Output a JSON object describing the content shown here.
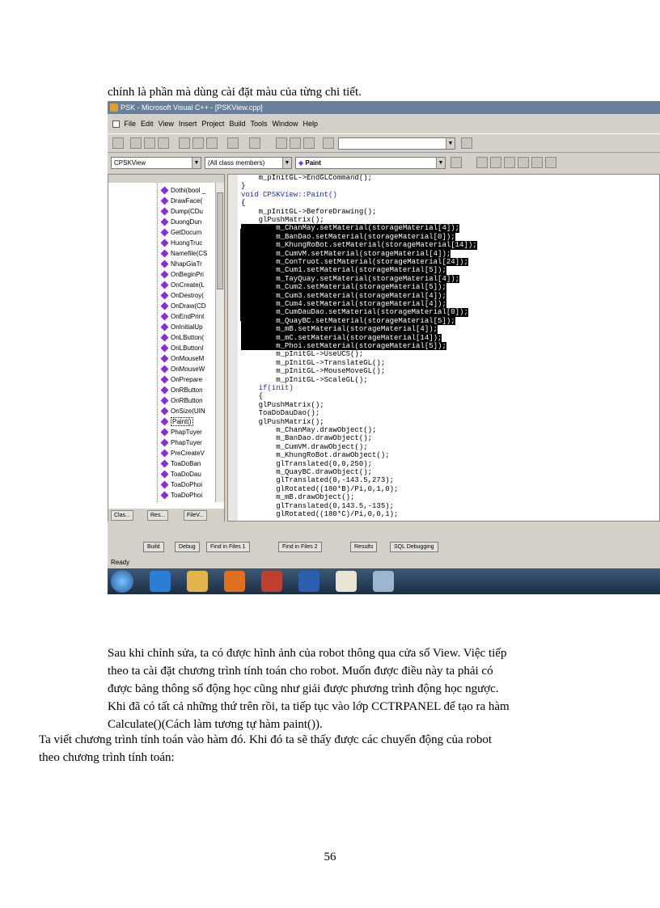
{
  "top_caption": "chính là phần mà dùng cài đặt màu của từng chi tiết.",
  "screenshot": {
    "title": "PSK - Microsoft Visual C++ - [PSKView.cpp]",
    "menu": [
      "File",
      "Edit",
      "View",
      "Insert",
      "Project",
      "Build",
      "Tools",
      "Window",
      "Help"
    ],
    "class_combo": "CPSKView",
    "members_combo": "(All class members)",
    "method_combo": "Paint",
    "class_tree": [
      "Dothi(bool _",
      "DrawFace(",
      "Dump(CDu",
      "DuongDun",
      "GetDocum",
      "HuongTruc",
      "Namefile(CS",
      "NhapGiaTr",
      "OnBeginPri",
      "OnCreate(L",
      "OnDestroy(",
      "OnDraw(CD",
      "OnEndPrint",
      "OnInitialUp",
      "OnLButton(",
      "OnLButtonI",
      "OnMouseM",
      "OnMouseW",
      "OnPrepare",
      "OnRButton",
      "OnRButton",
      "OnSize(UIN",
      "Paint()",
      "PhapTuyer",
      "PhapTuyer",
      "PreCreateV",
      "ToaDoBan",
      "ToaDoDau",
      "ToaDoPhoi",
      "ToaDoPhoi"
    ],
    "selected_item": "Paint()",
    "cv_tabs": [
      "Clas...",
      "Res...",
      "FileV..."
    ],
    "code_lines": [
      {
        "text": "    m_pInitGL->EndGLCommand();",
        "kind": "normal"
      },
      {
        "text": "}",
        "kind": "normal"
      },
      {
        "text": "void CPSKView::Paint()",
        "kind": "keyword"
      },
      {
        "text": "{",
        "kind": "normal"
      },
      {
        "text": "    m_pInitGL->BeforeDrawing();",
        "kind": "normal"
      },
      {
        "text": "    glPushMatrix();",
        "kind": "normal"
      },
      {
        "text": "        m_ChanMay.setMaterial(storageMaterial[4]);",
        "kind": "highlight"
      },
      {
        "text": "        m_BanDao.setMaterial(storageMaterial[0]);",
        "kind": "highlight"
      },
      {
        "text": "        m_KhungRoBot.setMaterial(storageMaterial[14]);",
        "kind": "highlight"
      },
      {
        "text": "        m_CumVM.setMaterial(storageMaterial[4]);",
        "kind": "highlight"
      },
      {
        "text": "        m_ConTruot.setMaterial(storageMaterial[24]);",
        "kind": "highlight"
      },
      {
        "text": "        m_Cum1.setMaterial(storageMaterial[5]);",
        "kind": "highlight"
      },
      {
        "text": "        m_TayQuay.setMaterial(storageMaterial[4]);",
        "kind": "highlight"
      },
      {
        "text": "        m_Cum2.setMaterial(storageMaterial[5]);",
        "kind": "highlight"
      },
      {
        "text": "        m_Cum3.setMaterial(storageMaterial[4]);",
        "kind": "highlight"
      },
      {
        "text": "        m_Cum4.setMaterial(storageMaterial[4]);",
        "kind": "highlight"
      },
      {
        "text": "        m_CumDauDao.setMaterial(storageMaterial[0]);",
        "kind": "highlight"
      },
      {
        "text": "        m_QuayBC.setMaterial(storageMaterial[5]);",
        "kind": "highlight"
      },
      {
        "text": "        m_mB.setMaterial(storageMaterial[4]);",
        "kind": "highlight"
      },
      {
        "text": "        m_mC.setMaterial(storageMaterial[14]);",
        "kind": "highlight"
      },
      {
        "text": "        m_Phoi.setMaterial(storageMaterial[5]);",
        "kind": "highlight"
      },
      {
        "text": "        m_pInitGL->UseUCS();",
        "kind": "normal"
      },
      {
        "text": "        m_pInitGL->TranslateGL();",
        "kind": "normal"
      },
      {
        "text": "        m_pInitGL->MouseMoveGL();",
        "kind": "normal"
      },
      {
        "text": "        m_pInitGL->ScaleGL();",
        "kind": "normal"
      },
      {
        "text": "    if(init)",
        "kind": "keyword"
      },
      {
        "text": "    {",
        "kind": "normal"
      },
      {
        "text": "    glPushMatrix();",
        "kind": "normal"
      },
      {
        "text": "    ToaDoDauDao();",
        "kind": "normal"
      },
      {
        "text": "    glPushMatrix();",
        "kind": "normal"
      },
      {
        "text": "        m_ChanMay.drawObject();",
        "kind": "normal"
      },
      {
        "text": "        m_BanDao.drawObject();",
        "kind": "normal"
      },
      {
        "text": "        m_CumVM.drawObject();",
        "kind": "normal"
      },
      {
        "text": "        m_KhungRoBot.drawObject();",
        "kind": "normal"
      },
      {
        "text": "        glTranslated(0,0,250);",
        "kind": "normal"
      },
      {
        "text": "        m_QuayBC.drawObject();",
        "kind": "normal"
      },
      {
        "text": "        glTranslated(0,-143.5,273);",
        "kind": "normal"
      },
      {
        "text": "        glRotated((180*B)/Pi,0,1,0);",
        "kind": "normal"
      },
      {
        "text": "        m_mB.drawObject();",
        "kind": "normal"
      },
      {
        "text": "        glTranslated(0,143.5,-135);",
        "kind": "normal"
      },
      {
        "text": "        glRotated((180*C)/Pi,0,0,1);",
        "kind": "normal"
      }
    ],
    "output_tabs": [
      "Build",
      "Debug",
      "Find in Files 1",
      "Find in Files 2",
      "Results",
      "SQL Debugging"
    ],
    "status": "Ready"
  },
  "paragraph_lines": [
    "Sau khi chỉnh sửa, ta có được hình ảnh của robot thông qua cửa sổ View. Việc tiếp",
    "theo ta cài đặt chương trình tính toán cho robot. Muốn được điều này ta phải có",
    "được bảng thông số động học cũng như giải được phương trình động học ngược.",
    "Khi đã có tất cả những thứ trên rồi, ta tiếp tục vào lớp CCTRPANEL để tạo ra hàm",
    "Calculate()(Cách làm tương tự hàm paint())."
  ],
  "closing_lines": [
    "Ta viết chương trình tính toán vào hàm đó. Khi đó ta sẽ thấy được các chuyển động của robot",
    "theo chương trình tính toán:"
  ],
  "page_number": "56"
}
